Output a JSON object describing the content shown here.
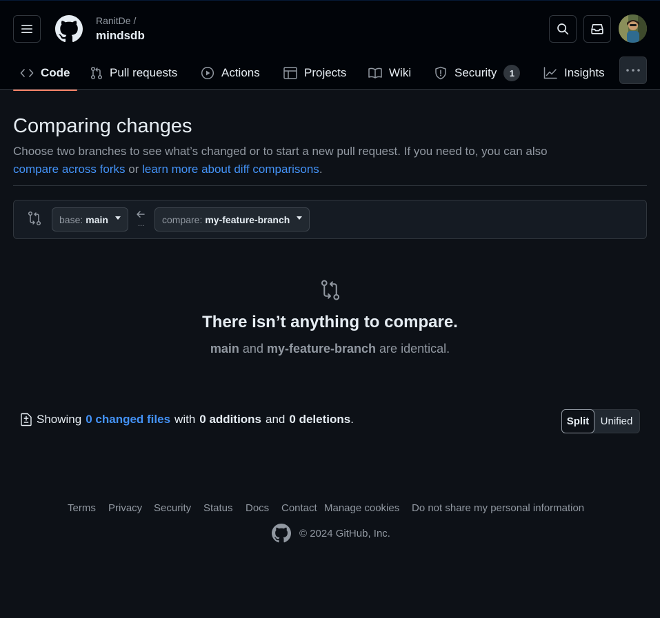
{
  "header": {
    "repo_owner": "RanitDe /",
    "repo_name": "mindsdb"
  },
  "nav": {
    "code": "Code",
    "pull_requests": "Pull requests",
    "actions": "Actions",
    "projects": "Projects",
    "wiki": "Wiki",
    "security": "Security",
    "security_count": "1",
    "insights": "Insights"
  },
  "main": {
    "title": "Comparing changes",
    "desc_text": "Choose two branches to see what’s changed or to start a new pull request. If you need to, you can also",
    "link_compare_forks": "compare across forks",
    "desc_or": "or",
    "link_learn_more": "learn more about diff comparisons",
    "desc_period": "."
  },
  "range": {
    "base_prefix": "base:",
    "base_branch": "main",
    "arrow_dots": "...",
    "compare_prefix": "compare:",
    "compare_branch": "my-feature-branch"
  },
  "blankslate": {
    "title": "There isn’t anything to compare.",
    "branch_a": "main",
    "and": "and",
    "branch_b": "my-feature-branch",
    "suffix": "are identical."
  },
  "summary": {
    "showing": "Showing",
    "changed_files": "0 changed files",
    "with": "with",
    "additions": "0 additions",
    "and": "and",
    "deletions": "0 deletions",
    "period": "."
  },
  "view_toggle": {
    "split": "Split",
    "unified": "Unified",
    "selected": "Split"
  },
  "footer": {
    "links": [
      "Terms",
      "Privacy",
      "Security",
      "Status",
      "Docs",
      "Contact",
      "Manage cookies",
      "Do not share my personal information"
    ],
    "copyright": "© 2024 GitHub, Inc."
  },
  "colors": {
    "background": "#0d1117",
    "header_bg": "#010409",
    "link": "#4493f8",
    "active_underline": "#f78166",
    "muted_text": "#9198a1"
  }
}
